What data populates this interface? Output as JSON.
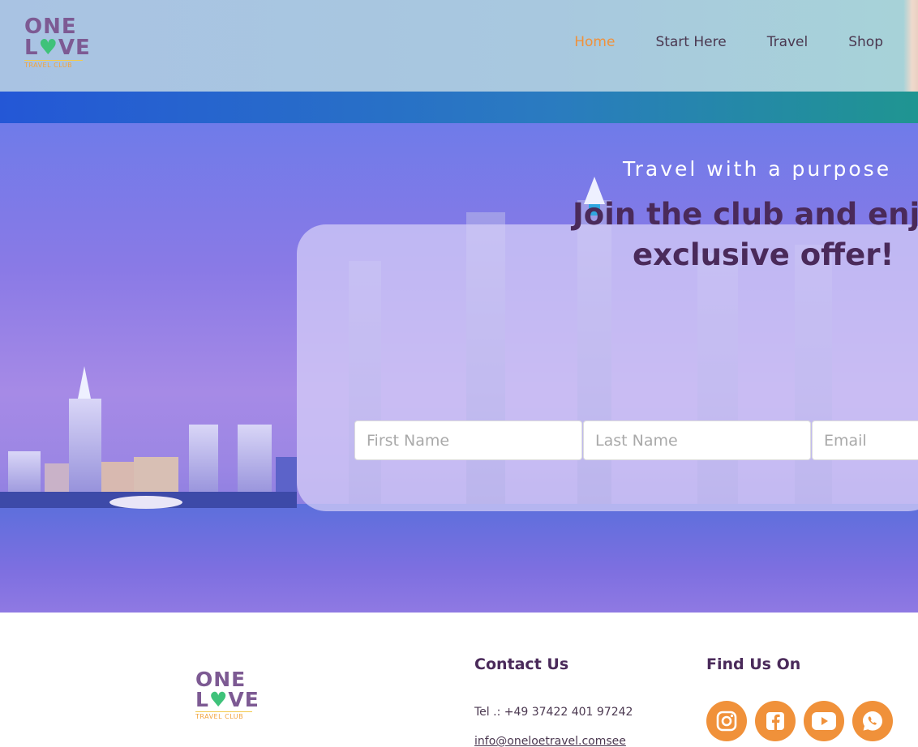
{
  "brand": {
    "logo_word_one": "ONE",
    "logo_word_love_l": "L",
    "logo_word_love_heart": "♥",
    "logo_word_love_ve": "VE",
    "logo_sub": "TRAVEL CLUB"
  },
  "nav": {
    "items": [
      {
        "label": "Home",
        "active": true
      },
      {
        "label": "Start Here",
        "active": false
      },
      {
        "label": "Travel",
        "active": false
      },
      {
        "label": "Shop",
        "active": false
      }
    ]
  },
  "hero": {
    "tagline": "Travel with a purpose",
    "headline_line1": "Join the club and enjoy",
    "headline_line2": "exclusive offer!",
    "form": {
      "first_name_placeholder": "First Name",
      "last_name_placeholder": "Last Name",
      "email_placeholder": "Email"
    }
  },
  "footer": {
    "contact_title": "Contact Us",
    "tel": "Tel .: +49 37422 401 97242",
    "email": "info@oneloetravel.comsee",
    "find_title": "Find Us On",
    "socials": [
      "instagram-icon",
      "facebook-icon",
      "youtube-icon",
      "whatsapp-icon"
    ]
  },
  "colors": {
    "accent": "#f0913a",
    "heading": "#4a2a5a",
    "brand_purple": "#7d5a93",
    "brand_green": "#3fc27a"
  }
}
